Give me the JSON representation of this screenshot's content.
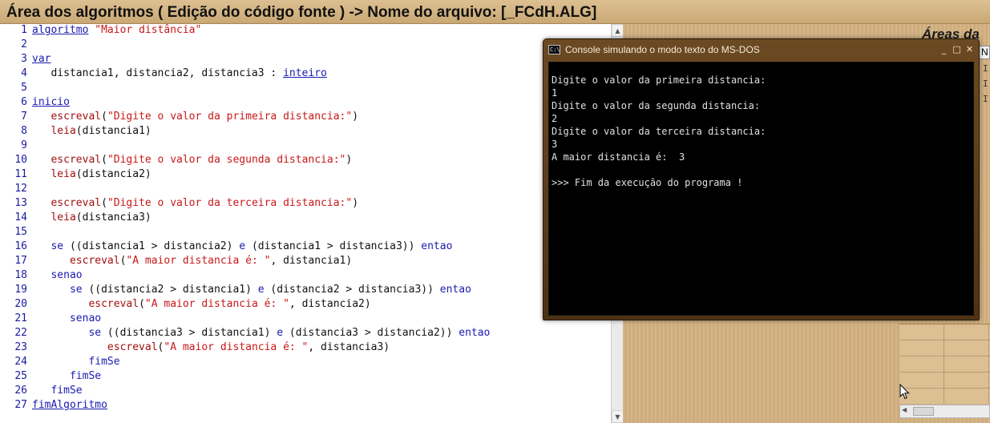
{
  "window": {
    "title": "Área dos algoritmos ( Edição do código fonte ) -> Nome do arquivo: [_FCdH.ALG]"
  },
  "editor": {
    "lines": [
      {
        "n": "1",
        "tokens": [
          {
            "t": "algoritmo",
            "c": "kw"
          },
          {
            "t": " ",
            "c": ""
          },
          {
            "t": "\"Maior distância\"",
            "c": "str"
          }
        ]
      },
      {
        "n": "2",
        "tokens": []
      },
      {
        "n": "3",
        "tokens": [
          {
            "t": "var",
            "c": "kw"
          }
        ]
      },
      {
        "n": "4",
        "tokens": [
          {
            "t": "   distancia1, distancia2, distancia3 : ",
            "c": ""
          },
          {
            "t": "inteiro",
            "c": "kw"
          }
        ]
      },
      {
        "n": "5",
        "tokens": []
      },
      {
        "n": "6",
        "tokens": [
          {
            "t": "inicio",
            "c": "kw"
          }
        ]
      },
      {
        "n": "7",
        "tokens": [
          {
            "t": "   ",
            "c": ""
          },
          {
            "t": "escreval",
            "c": "fn"
          },
          {
            "t": "(",
            "c": ""
          },
          {
            "t": "\"Digite o valor da primeira distancia:\"",
            "c": "str"
          },
          {
            "t": ")",
            "c": ""
          }
        ]
      },
      {
        "n": "8",
        "tokens": [
          {
            "t": "   ",
            "c": ""
          },
          {
            "t": "leia",
            "c": "fn"
          },
          {
            "t": "(distancia1)",
            "c": ""
          }
        ]
      },
      {
        "n": "9",
        "tokens": []
      },
      {
        "n": "10",
        "tokens": [
          {
            "t": "   ",
            "c": ""
          },
          {
            "t": "escreval",
            "c": "fn"
          },
          {
            "t": "(",
            "c": ""
          },
          {
            "t": "\"Digite o valor da segunda distancia:\"",
            "c": "str"
          },
          {
            "t": ")",
            "c": ""
          }
        ]
      },
      {
        "n": "11",
        "tokens": [
          {
            "t": "   ",
            "c": ""
          },
          {
            "t": "leia",
            "c": "fn"
          },
          {
            "t": "(distancia2)",
            "c": ""
          }
        ]
      },
      {
        "n": "12",
        "tokens": []
      },
      {
        "n": "13",
        "tokens": [
          {
            "t": "   ",
            "c": ""
          },
          {
            "t": "escreval",
            "c": "fn"
          },
          {
            "t": "(",
            "c": ""
          },
          {
            "t": "\"Digite o valor da terceira distancia:\"",
            "c": "str"
          },
          {
            "t": ")",
            "c": ""
          }
        ]
      },
      {
        "n": "14",
        "tokens": [
          {
            "t": "   ",
            "c": ""
          },
          {
            "t": "leia",
            "c": "fn"
          },
          {
            "t": "(distancia3)",
            "c": ""
          }
        ]
      },
      {
        "n": "15",
        "tokens": []
      },
      {
        "n": "16",
        "tokens": [
          {
            "t": "   ",
            "c": ""
          },
          {
            "t": "se",
            "c": "kw2"
          },
          {
            "t": " ((distancia1 > distancia2) ",
            "c": ""
          },
          {
            "t": "e",
            "c": "kw2"
          },
          {
            "t": " (distancia1 > distancia3)) ",
            "c": ""
          },
          {
            "t": "entao",
            "c": "kw2"
          }
        ]
      },
      {
        "n": "17",
        "tokens": [
          {
            "t": "      ",
            "c": ""
          },
          {
            "t": "escreval",
            "c": "fn"
          },
          {
            "t": "(",
            "c": ""
          },
          {
            "t": "\"A maior distancia é: \"",
            "c": "str"
          },
          {
            "t": ", distancia1)",
            "c": ""
          }
        ]
      },
      {
        "n": "18",
        "tokens": [
          {
            "t": "   ",
            "c": ""
          },
          {
            "t": "senao",
            "c": "kw2"
          }
        ]
      },
      {
        "n": "19",
        "tokens": [
          {
            "t": "      ",
            "c": ""
          },
          {
            "t": "se",
            "c": "kw2"
          },
          {
            "t": " ((distancia2 > distancia1) ",
            "c": ""
          },
          {
            "t": "e",
            "c": "kw2"
          },
          {
            "t": " (distancia2 > distancia3)) ",
            "c": ""
          },
          {
            "t": "entao",
            "c": "kw2"
          }
        ]
      },
      {
        "n": "20",
        "tokens": [
          {
            "t": "         ",
            "c": ""
          },
          {
            "t": "escreval",
            "c": "fn"
          },
          {
            "t": "(",
            "c": ""
          },
          {
            "t": "\"A maior distancia é: \"",
            "c": "str"
          },
          {
            "t": ", distancia2)",
            "c": ""
          }
        ]
      },
      {
        "n": "21",
        "tokens": [
          {
            "t": "      ",
            "c": ""
          },
          {
            "t": "senao",
            "c": "kw2"
          }
        ]
      },
      {
        "n": "22",
        "tokens": [
          {
            "t": "         ",
            "c": ""
          },
          {
            "t": "se",
            "c": "kw2"
          },
          {
            "t": " ((distancia3 > distancia1) ",
            "c": ""
          },
          {
            "t": "e",
            "c": "kw2"
          },
          {
            "t": " (distancia3 > distancia2)) ",
            "c": ""
          },
          {
            "t": "entao",
            "c": "kw2"
          }
        ]
      },
      {
        "n": "23",
        "tokens": [
          {
            "t": "            ",
            "c": ""
          },
          {
            "t": "escreval",
            "c": "fn"
          },
          {
            "t": "(",
            "c": ""
          },
          {
            "t": "\"A maior distancia é: \"",
            "c": "str"
          },
          {
            "t": ", distancia3)",
            "c": ""
          }
        ]
      },
      {
        "n": "24",
        "tokens": [
          {
            "t": "         ",
            "c": ""
          },
          {
            "t": "fimSe",
            "c": "kw2"
          }
        ]
      },
      {
        "n": "25",
        "tokens": [
          {
            "t": "      ",
            "c": ""
          },
          {
            "t": "fimSe",
            "c": "kw2"
          }
        ]
      },
      {
        "n": "26",
        "tokens": [
          {
            "t": "   ",
            "c": ""
          },
          {
            "t": "fimSe",
            "c": "kw2"
          }
        ]
      },
      {
        "n": "27",
        "tokens": [
          {
            "t": "fimAlgoritmo",
            "c": "kw"
          }
        ]
      }
    ]
  },
  "right_panel": {
    "areas_label": "Áreas da",
    "list_header": "N",
    "list_stubs": [
      "I",
      "I",
      "I"
    ]
  },
  "console": {
    "title": "Console simulando o modo texto do MS-DOS",
    "icon_text": "C:\\",
    "minimize": "_",
    "maximize": "□",
    "close": "✕",
    "lines": [
      "Digite o valor da primeira distancia:",
      "1",
      "Digite o valor da segunda distancia:",
      "2",
      "Digite o valor da terceira distancia:",
      "3",
      "A maior distancia é:  3",
      "",
      ">>> Fim da execução do programa !"
    ]
  },
  "icons": {
    "scroll_up": "▲",
    "scroll_down": "▼",
    "scroll_left": "◀"
  },
  "colors": {
    "keyword": "#1a1ab0",
    "string": "#c81818",
    "function": "#a01010",
    "console_bg": "#000000",
    "console_frame": "#5a3c1c"
  }
}
